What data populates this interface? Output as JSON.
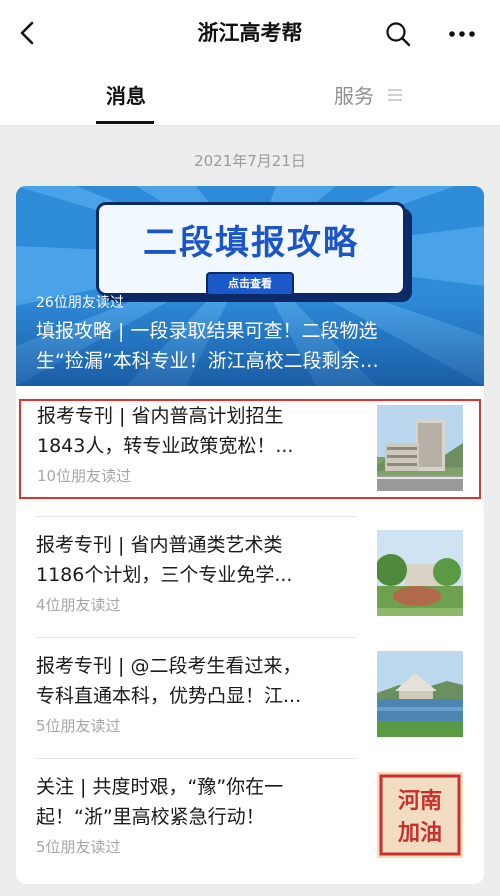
{
  "header": {
    "title": "浙江高考帮",
    "back_icon": "chevron-left-icon",
    "search_icon": "search-icon",
    "more_icon": "more-dots-icon"
  },
  "tabs": [
    {
      "label": "消息",
      "active": true
    },
    {
      "label": "服务",
      "active": false,
      "icon": "menu-icon"
    }
  ],
  "date": "2021年7月21日",
  "hero": {
    "banner_title": "二段填报攻略",
    "banner_button": "点击查看",
    "reads": "26位朋友读过",
    "title_line1": "填报攻略 | 一段录取结果可查！二段物选",
    "title_line2": "生“捡漏”本科专业！浙江高校二段剩余…"
  },
  "articles": [
    {
      "line1": "报考专刊 | 省内普高计划招生",
      "line2": "1843人，转专业政策宽松！...",
      "reads": "10位朋友读过",
      "thumb": "campus-building-photo",
      "highlighted": true
    },
    {
      "line1": "报考专刊 | 省内普通类艺术类",
      "line2": "1186个计划，三个专业免学...",
      "reads": "4位朋友读过",
      "thumb": "campus-garden-photo",
      "highlighted": false
    },
    {
      "line1": "报考专刊 | @二段考生看过来，",
      "line2": "专科直通本科，优势凸显！江...",
      "reads": "5位朋友读过",
      "thumb": "campus-lake-photo",
      "highlighted": false
    },
    {
      "line1": "关注 | 共度时艰，“豫”你在一",
      "line2": "起！“浙”里高校紧急行动！",
      "reads": "5位朋友读过",
      "thumb": "henan-poster",
      "thumb_text": "河南\n加油",
      "highlighted": false
    }
  ],
  "colors": {
    "accent_red": "#e1312d",
    "hero_blue": "#2e8bd8",
    "background": "#ededed"
  }
}
